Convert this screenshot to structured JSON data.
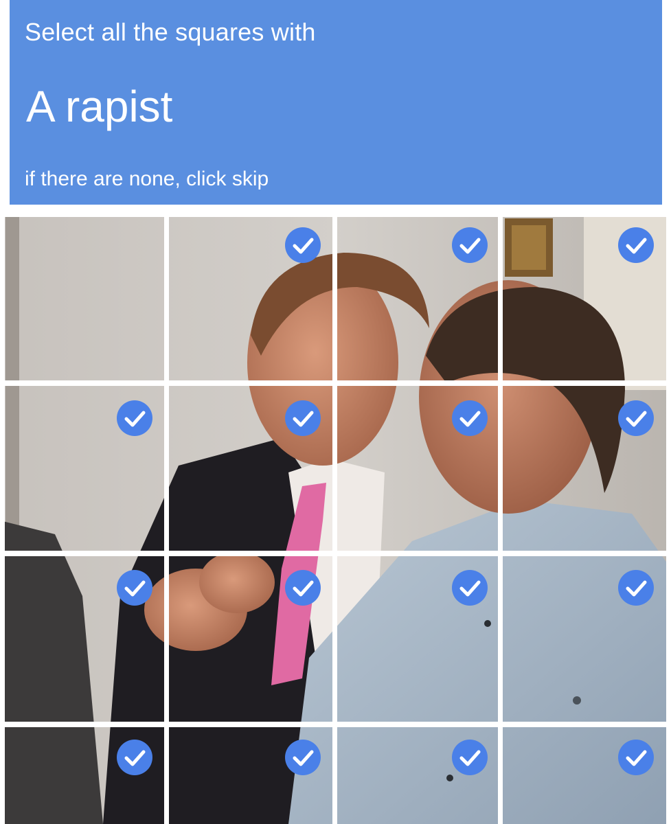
{
  "header": {
    "instruction": "Select all the squares with",
    "target": "A rapist",
    "skip_hint": "if there are none, click skip",
    "background_color": "#5a8fe0"
  },
  "grid": {
    "rows": 4,
    "columns": 4,
    "tiles": [
      {
        "row": 1,
        "col": 1,
        "selected": false
      },
      {
        "row": 1,
        "col": 2,
        "selected": true
      },
      {
        "row": 1,
        "col": 3,
        "selected": true
      },
      {
        "row": 1,
        "col": 4,
        "selected": true
      },
      {
        "row": 2,
        "col": 1,
        "selected": true
      },
      {
        "row": 2,
        "col": 2,
        "selected": true
      },
      {
        "row": 2,
        "col": 3,
        "selected": true
      },
      {
        "row": 2,
        "col": 4,
        "selected": true
      },
      {
        "row": 3,
        "col": 1,
        "selected": true
      },
      {
        "row": 3,
        "col": 2,
        "selected": true
      },
      {
        "row": 3,
        "col": 3,
        "selected": true
      },
      {
        "row": 3,
        "col": 4,
        "selected": true
      },
      {
        "row": 4,
        "col": 1,
        "selected": true
      },
      {
        "row": 4,
        "col": 2,
        "selected": true
      },
      {
        "row": 4,
        "col": 3,
        "selected": true
      },
      {
        "row": 4,
        "col": 4,
        "selected": true
      }
    ],
    "check_color": "#4a80e8",
    "check_icon": "checkmark-circle-icon"
  }
}
